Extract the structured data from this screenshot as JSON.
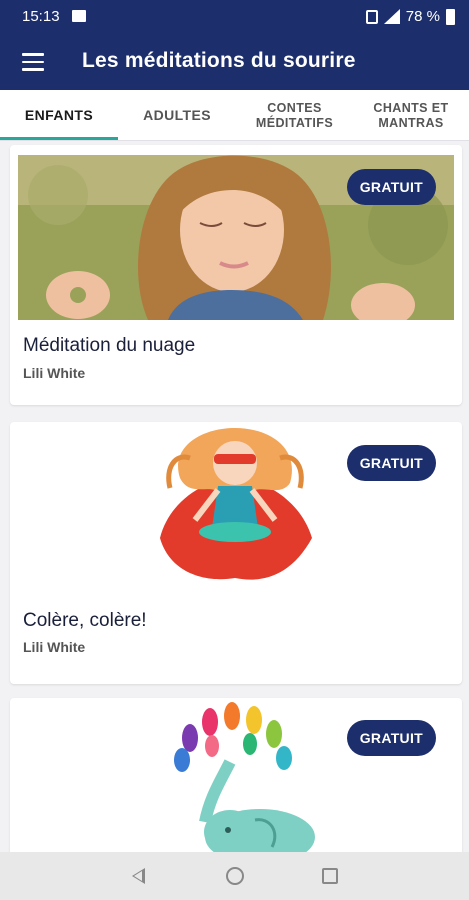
{
  "status": {
    "time": "15:13",
    "battery": "78 %"
  },
  "app": {
    "title": "Les méditations du sourire"
  },
  "tabs": [
    {
      "label": "ENFANTS",
      "active": true
    },
    {
      "label": "ADULTES",
      "active": false
    },
    {
      "label": "CONTES MÉDITATIFS",
      "active": false
    },
    {
      "label": "CHANTS ET MANTRAS",
      "active": false
    }
  ],
  "cards": [
    {
      "title": "Méditation du nuage",
      "author": "Lili White",
      "badge": "GRATUIT",
      "image": "girl-meditating-photo"
    },
    {
      "title": "Colère, colère!",
      "author": "Lili White",
      "badge": "GRATUIT",
      "image": "superhero-girl-meditating-illustration"
    },
    {
      "title": "",
      "author": "",
      "badge": "GRATUIT",
      "image": "elephant-color-splash-illustration"
    }
  ],
  "nav": {
    "back": "back-icon",
    "home": "home-icon",
    "recent": "recent-apps-icon"
  },
  "colors": {
    "primary": "#1c2e6b",
    "accent": "#2aa79b",
    "background": "#f2f2f4"
  }
}
